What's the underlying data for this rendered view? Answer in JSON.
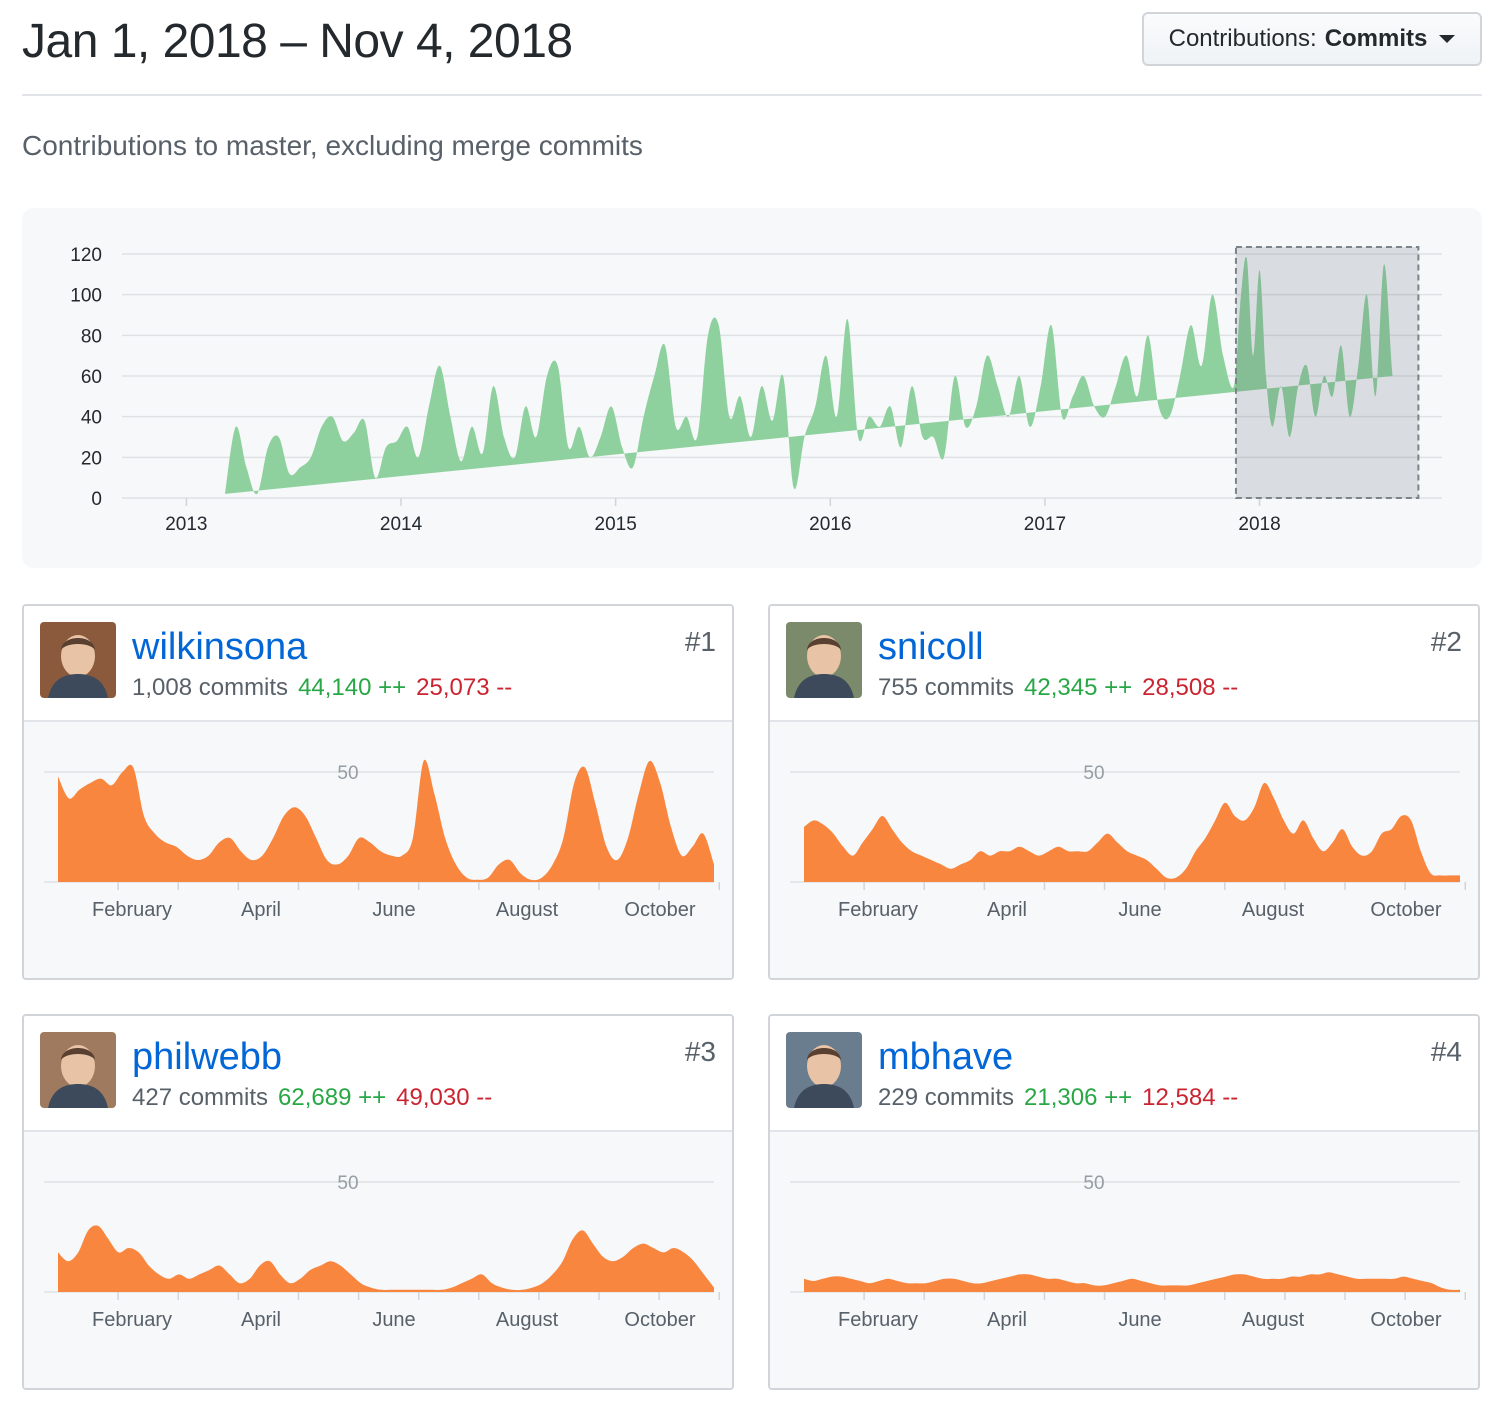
{
  "header": {
    "date_range": "Jan 1, 2018 – Nov 4, 2018",
    "select_prefix": "Contributions:",
    "select_value": "Commits"
  },
  "subtitle": "Contributions to master, excluding merge commits",
  "chart_data": [
    {
      "type": "area",
      "color": "#8fd19e",
      "selection_color": "#d1d5da",
      "y_ticks": [
        0,
        20,
        40,
        60,
        80,
        100,
        120
      ],
      "ylim": [
        0,
        120
      ],
      "x_ticks": [
        "2013",
        "2014",
        "2015",
        "2016",
        "2017",
        "2018"
      ],
      "xlim": [
        2012.7,
        2018.85
      ],
      "selection": [
        2017.89,
        2018.74
      ],
      "x": [
        2013.18,
        2013.23,
        2013.28,
        2013.33,
        2013.38,
        2013.43,
        2013.48,
        2013.53,
        2013.58,
        2013.63,
        2013.68,
        2013.73,
        2013.78,
        2013.83,
        2013.88,
        2013.93,
        2013.98,
        2014.03,
        2014.08,
        2014.13,
        2014.18,
        2014.23,
        2014.28,
        2014.33,
        2014.38,
        2014.43,
        2014.48,
        2014.53,
        2014.58,
        2014.63,
        2014.68,
        2014.73,
        2014.78,
        2014.83,
        2014.88,
        2014.93,
        2014.98,
        2015.03,
        2015.08,
        2015.13,
        2015.18,
        2015.23,
        2015.28,
        2015.33,
        2015.38,
        2015.43,
        2015.48,
        2015.53,
        2015.58,
        2015.63,
        2015.68,
        2015.73,
        2015.78,
        2015.83,
        2015.88,
        2015.93,
        2015.98,
        2016.03,
        2016.08,
        2016.13,
        2016.18,
        2016.23,
        2016.28,
        2016.33,
        2016.38,
        2016.43,
        2016.48,
        2016.53,
        2016.58,
        2016.63,
        2016.68,
        2016.73,
        2016.78,
        2016.83,
        2016.88,
        2016.93,
        2016.98,
        2017.03,
        2017.08,
        2017.13,
        2017.18,
        2017.23,
        2017.28,
        2017.33,
        2017.38,
        2017.43,
        2017.48,
        2017.53,
        2017.58,
        2017.63,
        2017.68,
        2017.73,
        2017.78,
        2017.83,
        2017.88,
        2017.91,
        2017.94,
        2017.97,
        2018.0,
        2018.03,
        2018.06,
        2018.1,
        2018.14,
        2018.18,
        2018.22,
        2018.26,
        2018.3,
        2018.34,
        2018.38,
        2018.42,
        2018.46,
        2018.5,
        2018.54,
        2018.58,
        2018.62,
        2018.66,
        2018.7,
        2018.74
      ],
      "y": [
        2,
        35,
        15,
        2,
        25,
        30,
        12,
        15,
        20,
        35,
        40,
        28,
        32,
        38,
        10,
        25,
        28,
        35,
        20,
        45,
        65,
        40,
        18,
        35,
        22,
        55,
        30,
        20,
        45,
        30,
        60,
        65,
        25,
        35,
        20,
        30,
        45,
        25,
        15,
        40,
        60,
        75,
        35,
        40,
        30,
        80,
        85,
        40,
        50,
        30,
        55,
        38,
        60,
        5,
        30,
        45,
        70,
        40,
        88,
        30,
        40,
        35,
        45,
        25,
        55,
        30,
        30,
        20,
        60,
        35,
        45,
        70,
        55,
        40,
        60,
        35,
        55,
        85,
        40,
        50,
        60,
        45,
        40,
        55,
        70,
        50,
        80,
        45,
        40,
        60,
        85,
        65,
        100,
        70,
        55,
        95,
        118,
        70,
        112,
        60,
        35,
        55,
        30,
        55,
        65,
        40,
        60,
        50,
        75,
        40,
        65,
        100,
        50,
        115,
        60,
        30
      ],
      "xlabel": "",
      "ylabel": ""
    },
    {
      "type": "area",
      "color": "#f9863f",
      "reference_line": 50,
      "x_ticks": [
        "February",
        "April",
        "June",
        "August",
        "October"
      ],
      "values": [
        48,
        38,
        42,
        45,
        47,
        44,
        50,
        52,
        30,
        22,
        18,
        16,
        12,
        10,
        12,
        18,
        20,
        14,
        10,
        12,
        20,
        30,
        34,
        30,
        20,
        10,
        8,
        12,
        20,
        18,
        14,
        12,
        12,
        20,
        55,
        40,
        20,
        8,
        2,
        1,
        2,
        8,
        10,
        4,
        1,
        2,
        8,
        20,
        45,
        52,
        35,
        16,
        10,
        20,
        40,
        55,
        45,
        25,
        12,
        16,
        22,
        8
      ]
    },
    {
      "type": "area",
      "color": "#f9863f",
      "reference_line": 50,
      "x_ticks": [
        "February",
        "April",
        "June",
        "August",
        "October"
      ],
      "values": [
        25,
        28,
        26,
        22,
        16,
        12,
        18,
        24,
        30,
        24,
        18,
        14,
        12,
        10,
        8,
        6,
        8,
        10,
        14,
        12,
        14,
        14,
        16,
        14,
        12,
        14,
        16,
        14,
        14,
        14,
        18,
        22,
        18,
        14,
        12,
        10,
        6,
        2,
        2,
        6,
        14,
        20,
        28,
        36,
        30,
        28,
        34,
        45,
        38,
        28,
        22,
        28,
        20,
        14,
        18,
        24,
        16,
        12,
        14,
        22,
        24,
        30,
        28,
        14,
        4,
        3,
        3,
        3
      ]
    },
    {
      "type": "area",
      "color": "#f9863f",
      "reference_line": 50,
      "x_ticks": [
        "February",
        "April",
        "June",
        "August",
        "October"
      ],
      "values": [
        18,
        14,
        18,
        28,
        30,
        24,
        18,
        20,
        18,
        12,
        8,
        6,
        8,
        6,
        8,
        10,
        12,
        8,
        4,
        6,
        12,
        14,
        8,
        4,
        6,
        10,
        12,
        14,
        12,
        8,
        4,
        2,
        1,
        1,
        1,
        1,
        1,
        1,
        1,
        2,
        4,
        6,
        8,
        4,
        2,
        1,
        1,
        2,
        4,
        8,
        14,
        24,
        28,
        22,
        16,
        14,
        16,
        20,
        22,
        20,
        18,
        20,
        18,
        14,
        8,
        2
      ]
    },
    {
      "type": "area",
      "color": "#f9863f",
      "reference_line": 50,
      "x_ticks": [
        "February",
        "April",
        "June",
        "August",
        "October"
      ],
      "values": [
        6,
        5,
        6,
        7,
        7,
        6,
        5,
        4,
        5,
        6,
        5,
        4,
        4,
        4,
        5,
        6,
        6,
        5,
        4,
        4,
        5,
        6,
        7,
        8,
        8,
        7,
        6,
        6,
        5,
        4,
        4,
        3,
        3,
        4,
        5,
        6,
        5,
        4,
        3,
        3,
        3,
        3,
        4,
        5,
        6,
        7,
        8,
        8,
        7,
        6,
        6,
        6,
        7,
        7,
        8,
        8,
        9,
        8,
        7,
        6,
        6,
        6,
        6,
        6,
        7,
        6,
        5,
        4,
        2,
        1,
        1
      ]
    }
  ],
  "contributors": [
    {
      "username": "wilkinsona",
      "rank": "#1",
      "commits": "1,008 commits",
      "additions": "44,140 ++",
      "deletions": "25,073 --",
      "avatar_color": "#8b5a3c"
    },
    {
      "username": "snicoll",
      "rank": "#2",
      "commits": "755 commits",
      "additions": "42,345 ++",
      "deletions": "28,508 --",
      "avatar_color": "#7a8a6a"
    },
    {
      "username": "philwebb",
      "rank": "#3",
      "commits": "427 commits",
      "additions": "62,689 ++",
      "deletions": "49,030 --",
      "avatar_color": "#a07a5e"
    },
    {
      "username": "mbhave",
      "rank": "#4",
      "commits": "229 commits",
      "additions": "21,306 ++",
      "deletions": "12,584 --",
      "avatar_color": "#6a7d8e"
    }
  ]
}
